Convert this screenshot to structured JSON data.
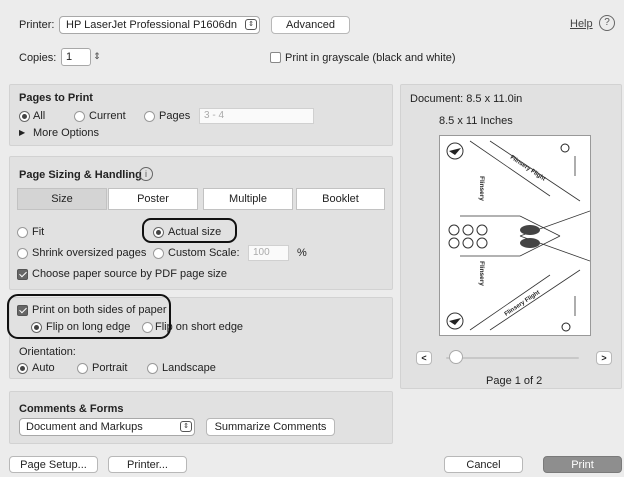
{
  "printer": {
    "label": "Printer:",
    "value": "HP LaserJet Professional P1606dn",
    "advanced_button": "Advanced",
    "help_link": "Help",
    "help_icon_glyph": "?"
  },
  "copies": {
    "label": "Copies:",
    "value": "1",
    "grayscale_label": "Print in grayscale (black and white)",
    "grayscale_checked": false
  },
  "pages": {
    "title": "Pages to Print",
    "all_label": "All",
    "current_label": "Current",
    "pages_label": "Pages",
    "range_placeholder": "3 - 4",
    "more_options": "More Options",
    "selected": "All"
  },
  "sizing": {
    "title": "Page Sizing & Handling",
    "info_glyph": "i",
    "tabs": [
      "Size",
      "Poster",
      "Multiple",
      "Booklet"
    ],
    "active_tab": "Size",
    "fit_label": "Fit",
    "actual_size_label": "Actual size",
    "shrink_label": "Shrink oversized pages",
    "custom_scale_label": "Custom Scale:",
    "custom_scale_value": "100",
    "percent": "%",
    "paper_source_label": "Choose paper source by PDF page size",
    "selected": "Actual size"
  },
  "duplex": {
    "label": "Print on both sides of paper",
    "checked": true,
    "long_edge": "Flip on long edge",
    "short_edge": "Flip on short edge",
    "selected": "Flip on long edge"
  },
  "orientation": {
    "label": "Orientation:",
    "auto": "Auto",
    "portrait": "Portrait",
    "landscape": "Landscape",
    "selected": "Auto"
  },
  "comments": {
    "title": "Comments & Forms",
    "value": "Document and Markups",
    "summarize_button": "Summarize Comments"
  },
  "preview": {
    "document_size": "Document: 8.5 x 11.0in",
    "paper_size": "8.5 x 11 Inches",
    "prev_glyph": "<",
    "next_glyph": ">",
    "page_indicator": "Page 1 of 2",
    "slider_position": 0.0,
    "art_text": [
      "Flinsery",
      "Flinsery Flight",
      "Flinsery Flight",
      "Flinsery"
    ]
  },
  "footer": {
    "page_setup": "Page Setup...",
    "printer_button": "Printer...",
    "cancel": "Cancel",
    "print": "Print"
  }
}
